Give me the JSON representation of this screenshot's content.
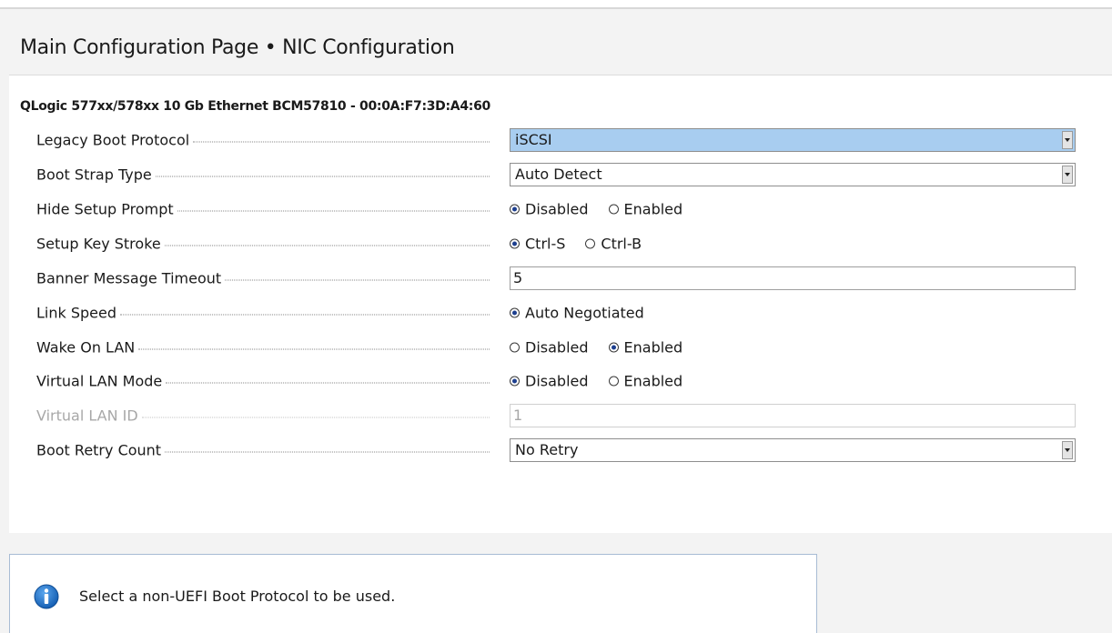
{
  "page": {
    "title": "Main Configuration Page • NIC Configuration",
    "device_heading": "QLogic 577xx/578xx 10 Gb Ethernet BCM57810 - 00:0A:F7:3D:A4:60"
  },
  "fields": {
    "legacy_boot_protocol": {
      "label": "Legacy Boot Protocol",
      "value": "iSCSI"
    },
    "boot_strap_type": {
      "label": "Boot Strap Type",
      "value": "Auto Detect"
    },
    "hide_setup_prompt": {
      "label": "Hide Setup Prompt",
      "options": [
        "Disabled",
        "Enabled"
      ],
      "selected": "Disabled"
    },
    "setup_key_stroke": {
      "label": "Setup Key Stroke",
      "options": [
        "Ctrl-S",
        "Ctrl-B"
      ],
      "selected": "Ctrl-S"
    },
    "banner_message_timeout": {
      "label": "Banner Message Timeout",
      "value": "5"
    },
    "link_speed": {
      "label": "Link Speed",
      "options": [
        "Auto Negotiated"
      ],
      "selected": "Auto Negotiated"
    },
    "wake_on_lan": {
      "label": "Wake On LAN",
      "options": [
        "Disabled",
        "Enabled"
      ],
      "selected": "Enabled"
    },
    "virtual_lan_mode": {
      "label": "Virtual LAN Mode",
      "options": [
        "Disabled",
        "Enabled"
      ],
      "selected": "Disabled"
    },
    "virtual_lan_id": {
      "label": "Virtual LAN ID",
      "value": "1",
      "disabled": true
    },
    "boot_retry_count": {
      "label": "Boot Retry Count",
      "value": "No Retry"
    }
  },
  "help": {
    "icon": "info-icon",
    "text": "Select a non-UEFI Boot Protocol to be used."
  },
  "colors": {
    "highlight": "#a8cdf0",
    "info_icon": "#1f6fc5",
    "help_border": "#a8bcd4"
  }
}
